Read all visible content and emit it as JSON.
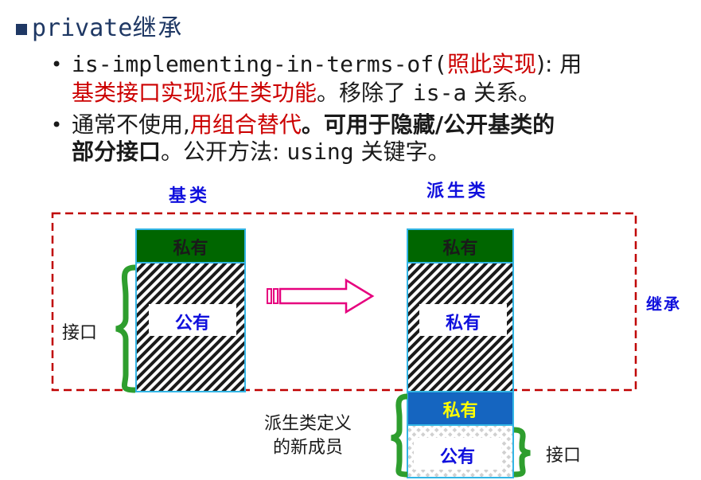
{
  "title": {
    "keyword": "private",
    "suffix": "继承"
  },
  "bullets": [
    {
      "line1": {
        "code": "is-implementing-in-terms-of(",
        "red": "照此实现",
        "after": "): 用"
      },
      "line2": {
        "red": "基类接口实现派生类功能",
        "after_cn": "。移除了 ",
        "code": "is-a",
        "end": " 关系。"
      }
    },
    {
      "line1": {
        "pre": "通常不使用,",
        "red": "用组合替代",
        "bold": "。可用于隐藏/公开基类的"
      },
      "line2": {
        "bold": "部分接口",
        "mid": "。公开方法: ",
        "code": "using",
        "end": " 关键字。"
      }
    }
  ],
  "diagram": {
    "base_label": "基类",
    "derived_label": "派生类",
    "inherit_label": "继承",
    "base": {
      "private": "私有",
      "public": "公有",
      "interface": "接口"
    },
    "derived": {
      "private": "私有",
      "public_as_private": "私有"
    },
    "new_members": {
      "label_line1": "派生类定义",
      "label_line2": "的新成员",
      "private": "私有",
      "public": "公有",
      "interface": "接口"
    }
  },
  "colors": {
    "title": "#1f3864",
    "red": "#cc0000",
    "green": "#006600",
    "brace": "#2e9e2e",
    "dash": "#c00000",
    "box_border": "#33b5e5",
    "blue_label": "#1010dd",
    "new_private": "#1565c0",
    "yellow": "#ffff00",
    "arrow": "#e6007e"
  }
}
